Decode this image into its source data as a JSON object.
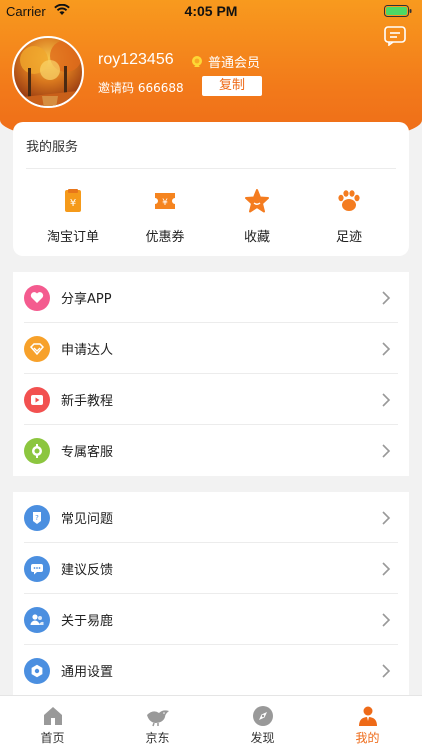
{
  "status_bar": {
    "carrier": "Carrier",
    "time": "4:05 PM"
  },
  "profile": {
    "username": "roy123456",
    "vip_label": "普通会员",
    "invite_label": "邀请码 666688",
    "copy_label": "复制"
  },
  "services": {
    "title": "我的服务",
    "items": [
      {
        "label": "淘宝订单",
        "icon": "taobao-order-icon"
      },
      {
        "label": "优惠券",
        "icon": "coupon-icon"
      },
      {
        "label": "收藏",
        "icon": "star-icon"
      },
      {
        "label": "足迹",
        "icon": "paw-icon"
      }
    ]
  },
  "menu_group_1": [
    {
      "label": "分享APP",
      "icon": "heart-icon",
      "color": "#f45b8f"
    },
    {
      "label": "申请达人",
      "icon": "diamond-icon",
      "color": "#f7a12a"
    },
    {
      "label": "新手教程",
      "icon": "play-icon",
      "color": "#f25150"
    },
    {
      "label": "专属客服",
      "icon": "service-icon",
      "color": "#8cc63f"
    }
  ],
  "menu_group_2": [
    {
      "label": "常见问题",
      "icon": "question-icon",
      "color": "#4b8fe0"
    },
    {
      "label": "建议反馈",
      "icon": "chat-icon",
      "color": "#4b8fe0"
    },
    {
      "label": "关于易鹿",
      "icon": "people-icon",
      "color": "#4b8fe0"
    },
    {
      "label": "通用设置",
      "icon": "gear-icon",
      "color": "#4b8fe0"
    }
  ],
  "tabs": [
    {
      "label": "首页",
      "icon": "home-icon",
      "active": false
    },
    {
      "label": "京东",
      "icon": "jd-bird-icon",
      "active": false
    },
    {
      "label": "发现",
      "icon": "compass-icon",
      "active": false
    },
    {
      "label": "我的",
      "icon": "user-icon",
      "active": true
    }
  ],
  "colors": {
    "accent": "#ee6a18",
    "header_top": "#f89a1e"
  }
}
